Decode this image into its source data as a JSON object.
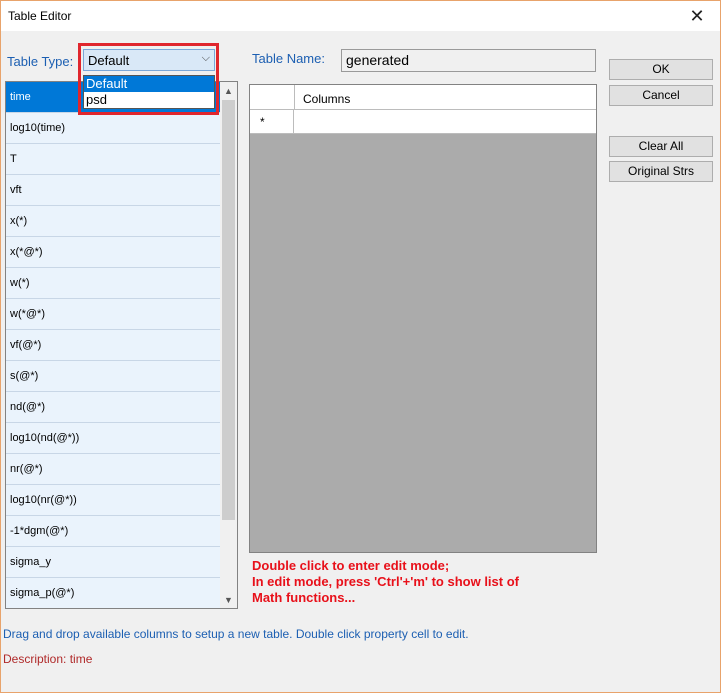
{
  "window": {
    "title": "Table Editor",
    "close_glyph": "✕"
  },
  "table_type": {
    "label": "Table Type:",
    "selected": "Default",
    "options": [
      "Default",
      "psd"
    ]
  },
  "table_name": {
    "label": "Table Name:",
    "value": "generated"
  },
  "available_columns": [
    "time",
    "log10(time)",
    "T",
    "vft",
    "x(*)",
    "x(*@*)",
    "w(*)",
    "w(*@*)",
    "vf(@*)",
    "s(@*)",
    "nd(@*)",
    "log10(nd(@*))",
    "nr(@*)",
    "log10(nr(@*))",
    "-1*dgm(@*)",
    "sigma_y",
    "sigma_p(@*)"
  ],
  "selected_column_index": 0,
  "grid": {
    "column_header": "Columns",
    "new_row_marker": "*"
  },
  "buttons": {
    "ok": "OK",
    "cancel": "Cancel",
    "clear_all": "Clear All",
    "original_strs": "Original Strs"
  },
  "note_lines": [
    "Double click to enter edit mode;",
    "In edit mode, press 'Ctrl'+'m' to show list of",
    "Math functions..."
  ],
  "status": {
    "hint": "Drag and drop available columns to setup a new table. Double click property cell to edit.",
    "description": "Description: time"
  },
  "icons": {
    "dropdown": "chevron-down-icon",
    "scroll_up": "scroll-up-icon",
    "scroll_down": "scroll-down-icon",
    "close": "close-icon"
  },
  "colors": {
    "accent": "#0078d7",
    "label_blue": "#1c5fb2",
    "note_red": "#e8101a",
    "highlight_red": "#e0262d"
  }
}
